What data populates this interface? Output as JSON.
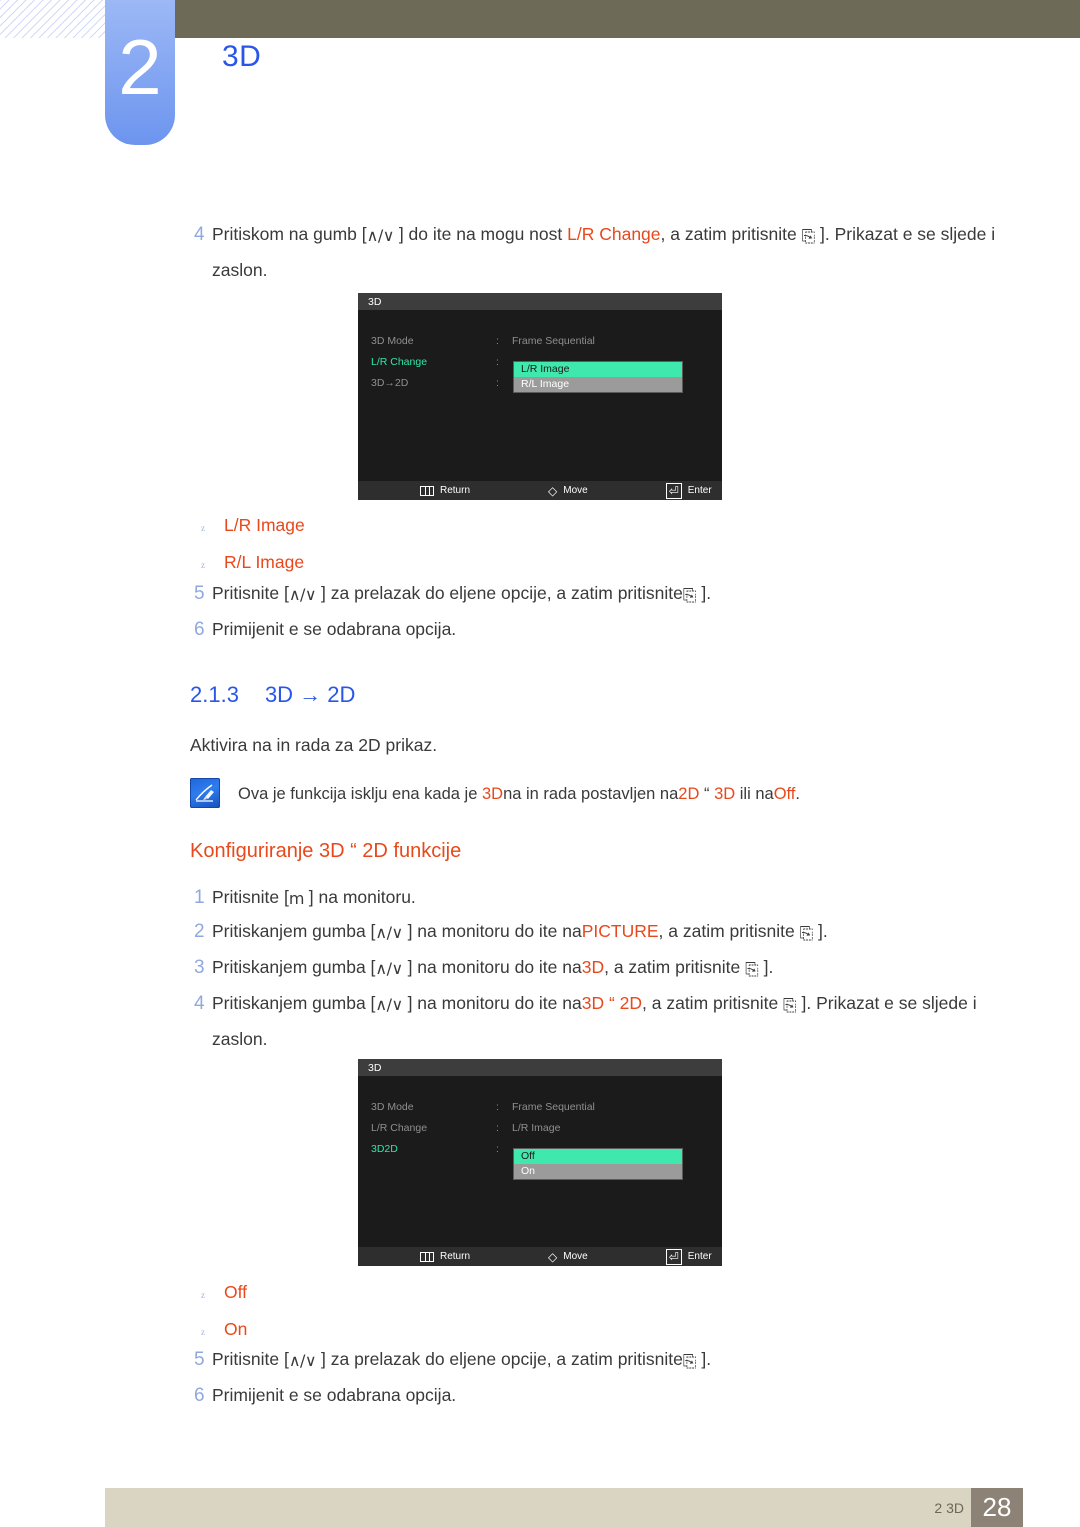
{
  "header": {
    "chapter_number": "2",
    "chapter_title": "3D"
  },
  "steps_group_1": [
    {
      "num": "4",
      "parts": [
        {
          "t": "Pritiskom na gumb [",
          "c": "plain"
        },
        {
          "t": "∧/∨",
          "c": "kbd"
        },
        {
          "t": " ] do ite na mogu nost ",
          "c": "plain"
        },
        {
          "t": "L/R Change",
          "c": "red"
        },
        {
          "t": ", a zatim pritisnite ",
          "c": "plain"
        },
        {
          "t": "⎘",
          "c": "enter"
        },
        {
          "t": " ]. Prikazat e se sljede i zaslon.",
          "c": "plain"
        }
      ]
    }
  ],
  "osd_1": {
    "title": "3D",
    "rows": [
      {
        "label": "3D Mode",
        "colon": ":",
        "value": "Frame Sequential",
        "active": false
      },
      {
        "label": "L/R Change",
        "colon": ":",
        "value": "",
        "active": true
      },
      {
        "label": "3D→2D",
        "colon": ":",
        "value": "",
        "active": false
      }
    ],
    "dropdown": {
      "options": [
        "L/R Image",
        "R/L Image"
      ],
      "selected_index": 0
    },
    "footer": [
      {
        "icon": "menu-icon",
        "label": "Return"
      },
      {
        "icon": "diamond-icon",
        "label": "Move"
      },
      {
        "icon": "enter-icon",
        "label": "Enter"
      }
    ]
  },
  "bullets_1": [
    "L/R Image",
    "R/L Image"
  ],
  "steps_group_2": [
    {
      "num": "5",
      "parts": [
        {
          "t": "Pritisnite [",
          "c": "plain"
        },
        {
          "t": "∧/∨",
          "c": "kbd"
        },
        {
          "t": " ] za prelazak do eljene opcije, a zatim pritisnite",
          "c": "plain"
        },
        {
          "t": "⎘",
          "c": "enter"
        },
        {
          "t": "  ].",
          "c": "plain"
        }
      ]
    },
    {
      "num": "6",
      "parts": [
        {
          "t": "Primijenit e se odabrana opcija.",
          "c": "plain"
        }
      ]
    }
  ],
  "section": {
    "number": "2.1.3",
    "title": "3D → 2D",
    "intro": "Aktivira na in rada za 2D prikaz."
  },
  "note": {
    "icon": "note-pen-icon",
    "parts": [
      {
        "t": "Ova je funkcija isklju ena kada je ",
        "c": "plain"
      },
      {
        "t": "3D",
        "c": "red"
      },
      {
        "t": "na in rada postavljen na",
        "c": "plain"
      },
      {
        "t": "2D ",
        "c": "red"
      },
      {
        "t": " “ ",
        "c": "plain"
      },
      {
        "t": "  3D",
        "c": "red"
      },
      {
        "t": " ili na",
        "c": "plain"
      },
      {
        "t": "Off",
        "c": "red"
      },
      {
        "t": ".",
        "c": "plain"
      }
    ]
  },
  "subheading": "Konfiguriranje 3D  “  2D funkcije",
  "steps_group_3": [
    {
      "num": "1",
      "parts": [
        {
          "t": "Pritisnite [",
          "c": "plain"
        },
        {
          "t": "m",
          "c": "kbd"
        },
        {
          "t": "  ] na monitoru.",
          "c": "plain"
        }
      ]
    },
    {
      "num": "2",
      "parts": [
        {
          "t": "Pritiskanjem gumba [",
          "c": "plain"
        },
        {
          "t": "∧/∨",
          "c": "kbd"
        },
        {
          "t": " ] na monitoru do ite na",
          "c": "plain"
        },
        {
          "t": "PICTURE",
          "c": "red"
        },
        {
          "t": ", a zatim pritisnite ",
          "c": "plain"
        },
        {
          "t": "⎘",
          "c": "enter"
        },
        {
          "t": " ].",
          "c": "plain"
        }
      ]
    },
    {
      "num": "3",
      "parts": [
        {
          "t": "Pritiskanjem gumba [",
          "c": "plain"
        },
        {
          "t": "∧/∨",
          "c": "kbd"
        },
        {
          "t": " ] na monitoru do ite na",
          "c": "plain"
        },
        {
          "t": "3D",
          "c": "red"
        },
        {
          "t": ", a zatim pritisnite ",
          "c": "plain"
        },
        {
          "t": "⎘",
          "c": "enter"
        },
        {
          "t": " ].",
          "c": "plain"
        }
      ]
    },
    {
      "num": "4",
      "parts": [
        {
          "t": "Pritiskanjem gumba [",
          "c": "plain"
        },
        {
          "t": "∧/∨",
          "c": "kbd"
        },
        {
          "t": " ] na monitoru do ite na",
          "c": "plain"
        },
        {
          "t": "3D  “  2D",
          "c": "red"
        },
        {
          "t": ", a zatim pritisnite ",
          "c": "plain"
        },
        {
          "t": "⎘",
          "c": "enter"
        },
        {
          "t": " ]. Prikazat e se sljede i zaslon.",
          "c": "plain"
        }
      ]
    }
  ],
  "osd_2": {
    "title": "3D",
    "rows": [
      {
        "label": "3D Mode",
        "colon": ":",
        "value": "Frame Sequential",
        "active": false
      },
      {
        "label": "L/R Change",
        "colon": ":",
        "value": "L/R Image",
        "active": false
      },
      {
        "label": "3D2D",
        "colon": ":",
        "value": "",
        "active": true
      }
    ],
    "dropdown": {
      "options": [
        "Off",
        "On"
      ],
      "selected_index": 0
    },
    "footer": [
      {
        "icon": "menu-icon",
        "label": "Return"
      },
      {
        "icon": "diamond-icon",
        "label": "Move"
      },
      {
        "icon": "enter-icon",
        "label": "Enter"
      }
    ]
  },
  "bullets_2": [
    "Off",
    "On"
  ],
  "steps_group_4": [
    {
      "num": "5",
      "parts": [
        {
          "t": "Pritisnite [",
          "c": "plain"
        },
        {
          "t": "∧/∨",
          "c": "kbd"
        },
        {
          "t": " ] za prelazak do eljene opcije, a zatim pritisnite",
          "c": "plain"
        },
        {
          "t": "⎘",
          "c": "enter"
        },
        {
          "t": "  ].",
          "c": "plain"
        }
      ]
    },
    {
      "num": "6",
      "parts": [
        {
          "t": "Primijenit e se odabrana opcija.",
          "c": "plain"
        }
      ]
    }
  ],
  "footer": {
    "breadcrumb": "2 3D",
    "page_number": "28"
  },
  "colors": {
    "accent_red": "#e8491c",
    "accent_blue": "#2a56e8",
    "chapter_tab": "#6d95ef",
    "header_bar": "#6d6b58",
    "osd_highlight": "#3fe8ad",
    "footer_bar": "#d9d5c2",
    "footer_page_box": "#8c8275"
  }
}
